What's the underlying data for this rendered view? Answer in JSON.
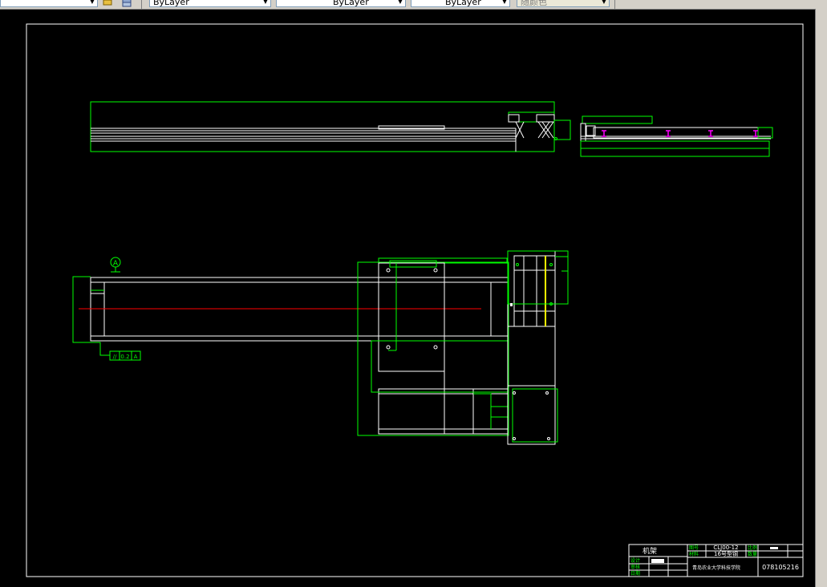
{
  "toolbar": {
    "color_control": "ByLayer",
    "linetype_control": "ByLayer",
    "lineweight_control": "ByLayer",
    "plotstyle_control": "随颜色"
  },
  "drawing": {
    "datum_label": "A",
    "tolerance": {
      "symbol": "//",
      "value": "0.2",
      "datum": "A"
    }
  },
  "title_block": {
    "part_name": "机架",
    "drawing_no_label": "图号",
    "drawing_no": "CLJ00-12",
    "material_label": "材料",
    "material": "16号型钢",
    "scale_label": "比例",
    "quantity_label": "数量",
    "designer_label": "设计",
    "checker_label": "审核",
    "date_label": "日期",
    "school": "青岛农业大学科技学院",
    "student_no": "078105216"
  },
  "colors": {
    "background": "#000000",
    "outline": "#ffffff",
    "construction": "#00ff00",
    "centerline": "#ff0000",
    "highlight": "#ffff00",
    "marker": "#ff00ff"
  }
}
